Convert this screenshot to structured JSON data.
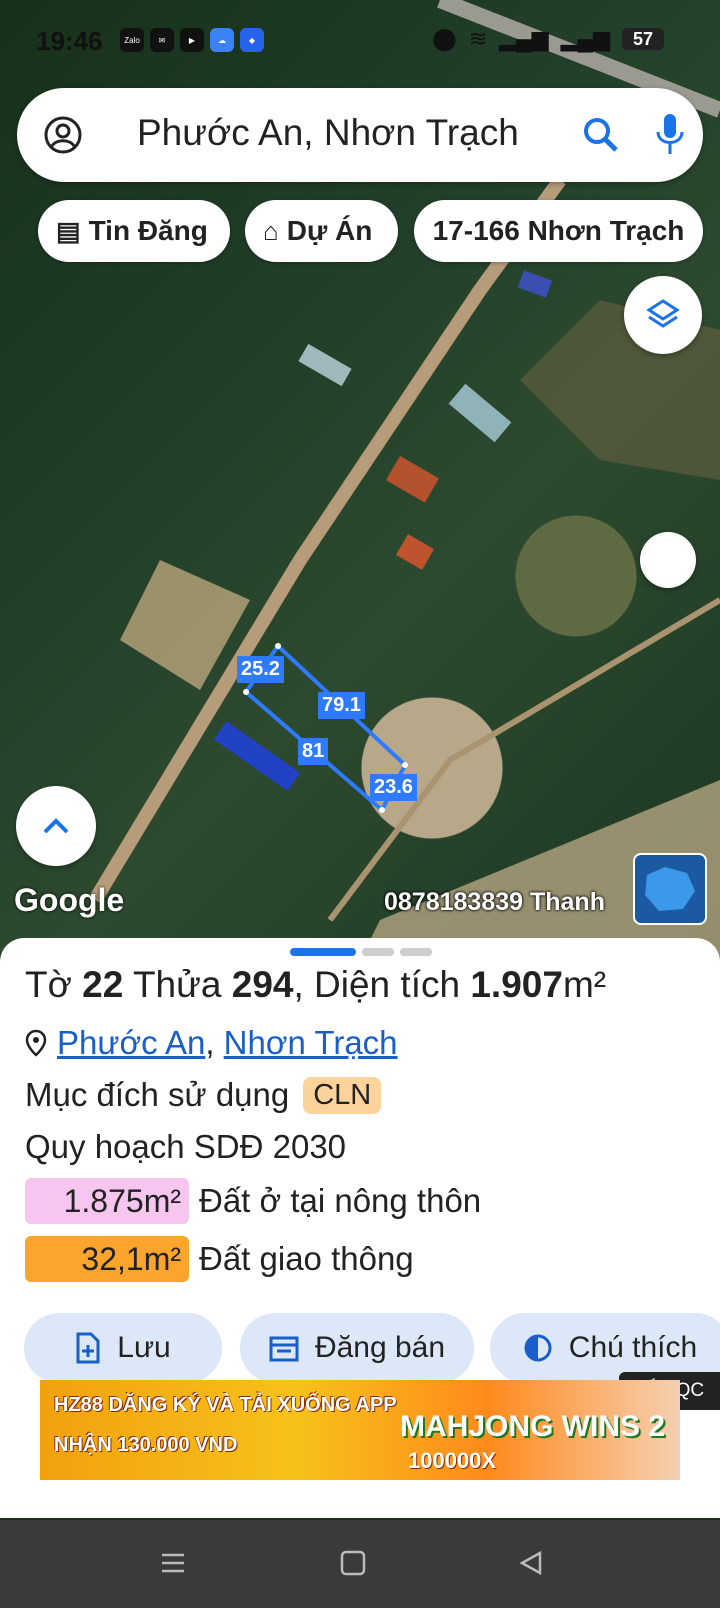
{
  "status": {
    "time": "19:46",
    "battery": "57",
    "app_icons": [
      "zalo",
      "messenger",
      "youtube",
      "cloud",
      "browser"
    ]
  },
  "search": {
    "value": "Phước An, Nhơn Trạch"
  },
  "chips": [
    {
      "label": "Tin Đăng",
      "icon": "listing-icon"
    },
    {
      "label": "Dự Án",
      "icon": "building-icon"
    },
    {
      "label": "17-166 Nhơn Trạch"
    }
  ],
  "map": {
    "measurements": {
      "top": "25.2",
      "upper_side": "79.1",
      "lower_side": "81",
      "bottom": "23.6"
    },
    "provider": "Google",
    "watermark": "0878183839 Thanh"
  },
  "parcel": {
    "title_prefix": "Tờ",
    "sheet_no": "22",
    "plot_label": "Thửa",
    "plot_no": "294",
    "area_label": ", Diện tích",
    "area_value": "1.907",
    "area_unit": "m²",
    "ward": "Phước An",
    "district": "Nhơn Trạch",
    "purpose_label": "Mục đích sử dụng",
    "purpose_code": "CLN",
    "plan_label": "Quy hoạch SDĐ 2030",
    "zones": [
      {
        "area": "1.875m²",
        "label": "Đất ở tại nông thôn",
        "color": "#f7c6ee"
      },
      {
        "area": "32,1m²",
        "label": "Đất giao thông",
        "color": "#fba52c"
      }
    ]
  },
  "actions": {
    "save": "Lưu",
    "sell": "Đăng bán",
    "legend": "Chú thích"
  },
  "ad": {
    "close_label": "TẮT QC",
    "line1": "HZ88 DĂNG KÝ VÀ TẢI XUỐNG APP",
    "line2": "NHẬN 130.000 VND",
    "game": "MAHJONG WINS 2",
    "prize": "100000X"
  },
  "colors": {
    "accent": "#1a73e8",
    "parcel_line": "#2f7bff"
  }
}
